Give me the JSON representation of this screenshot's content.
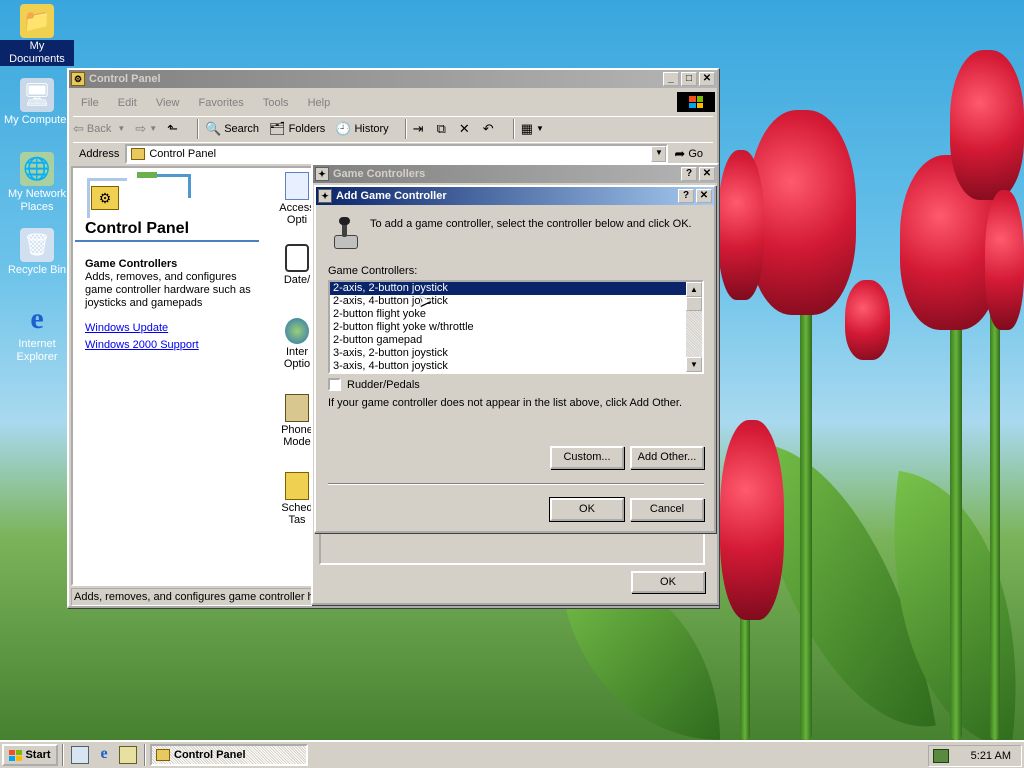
{
  "desktop": {
    "icons": [
      {
        "label": "My Documents"
      },
      {
        "label": "My Computer"
      },
      {
        "label": "My Network Places"
      },
      {
        "label": "Recycle Bin"
      },
      {
        "label": "Internet Explorer"
      }
    ]
  },
  "control_panel": {
    "title": "Control Panel",
    "menu": [
      "File",
      "Edit",
      "View",
      "Favorites",
      "Tools",
      "Help"
    ],
    "toolbar": {
      "back": "Back",
      "search": "Search",
      "folders": "Folders",
      "history": "History"
    },
    "address_label": "Address",
    "address_value": "Control Panel",
    "go_label": "Go",
    "heading": "Control Panel",
    "selected_item_title": "Game Controllers",
    "selected_item_desc": "Adds, removes, and configures game controller hardware such as joysticks and gamepads",
    "links": [
      "Windows Update",
      "Windows 2000 Support"
    ],
    "icon_labels": [
      "Access",
      "Opti",
      "Date/",
      "Inter",
      "Optio",
      "Phone",
      "Mode",
      "Sched",
      "Tas"
    ],
    "status_text": "Adds, removes, and configures game controller ha"
  },
  "game_controllers": {
    "title": "Game Controllers",
    "ok_label": "OK"
  },
  "add_controller": {
    "title": "Add Game Controller",
    "instruction": "To add a game controller, select the controller below and click OK.",
    "list_label": "Game Controllers:",
    "items": [
      "2-axis, 2-button joystick",
      "2-axis, 4-button joystick",
      "2-button flight yoke",
      "2-button flight yoke w/throttle",
      "2-button gamepad",
      "3-axis, 2-button joystick",
      "3-axis, 4-button joystick"
    ],
    "selected_index": 0,
    "rudder_label": "Rudder/Pedals",
    "rudder_checked": false,
    "note": "If your game controller does not appear in the list above, click Add Other.",
    "custom_label": "Custom...",
    "add_other_label": "Add Other...",
    "ok_label": "OK",
    "cancel_label": "Cancel"
  },
  "taskbar": {
    "start_label": "Start",
    "task_label": "Control Panel",
    "clock": "5:21 AM"
  }
}
